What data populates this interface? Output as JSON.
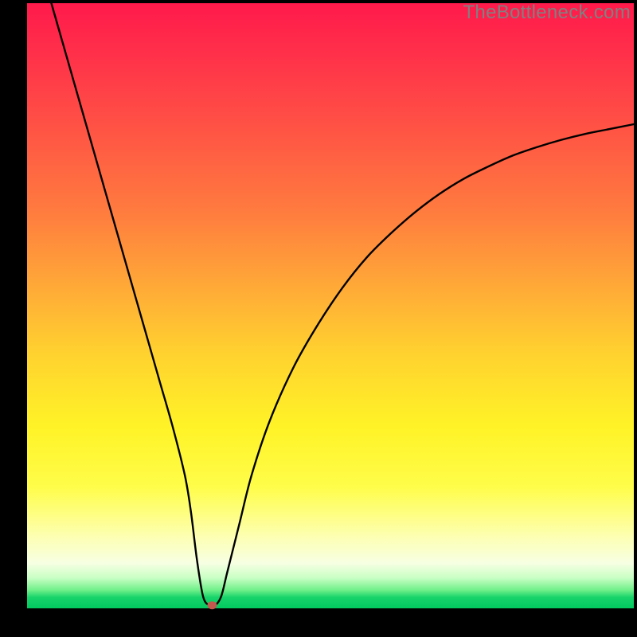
{
  "watermark": "TheBottleneck.com",
  "chart_data": {
    "type": "line",
    "title": "",
    "xlabel": "",
    "ylabel": "",
    "xlim": [
      0,
      100
    ],
    "ylim": [
      0,
      100
    ],
    "grid": false,
    "legend": false,
    "background": "rainbow-vertical",
    "series": [
      {
        "name": "bottleneck-curve",
        "x": [
          4,
          6,
          8,
          10,
          12,
          14,
          16,
          18,
          20,
          22,
          24,
          26,
          27,
          28,
          29,
          30,
          31,
          32,
          33,
          35,
          37,
          40,
          44,
          48,
          52,
          56,
          60,
          64,
          68,
          72,
          76,
          80,
          84,
          88,
          92,
          96,
          100
        ],
        "y": [
          100,
          93,
          86,
          79,
          72,
          65,
          58,
          51,
          44,
          37,
          30,
          22,
          16,
          8,
          2,
          0.5,
          0.5,
          2,
          6,
          14,
          22,
          31,
          40,
          47,
          53,
          58,
          62,
          65.5,
          68.5,
          71,
          73,
          74.8,
          76.2,
          77.4,
          78.4,
          79.2,
          80
        ]
      }
    ],
    "marker": {
      "x": 30.5,
      "y": 0.5,
      "color": "#c4584f",
      "rx": 6,
      "ry": 5
    },
    "gradient_stops": [
      {
        "pos": 0,
        "color": "#ff1a4b"
      },
      {
        "pos": 0.2,
        "color": "#ff5145"
      },
      {
        "pos": 0.46,
        "color": "#ffa638"
      },
      {
        "pos": 0.7,
        "color": "#fff327"
      },
      {
        "pos": 0.92,
        "color": "#f7ffe3"
      },
      {
        "pos": 1.0,
        "color": "#02c95f"
      }
    ]
  }
}
